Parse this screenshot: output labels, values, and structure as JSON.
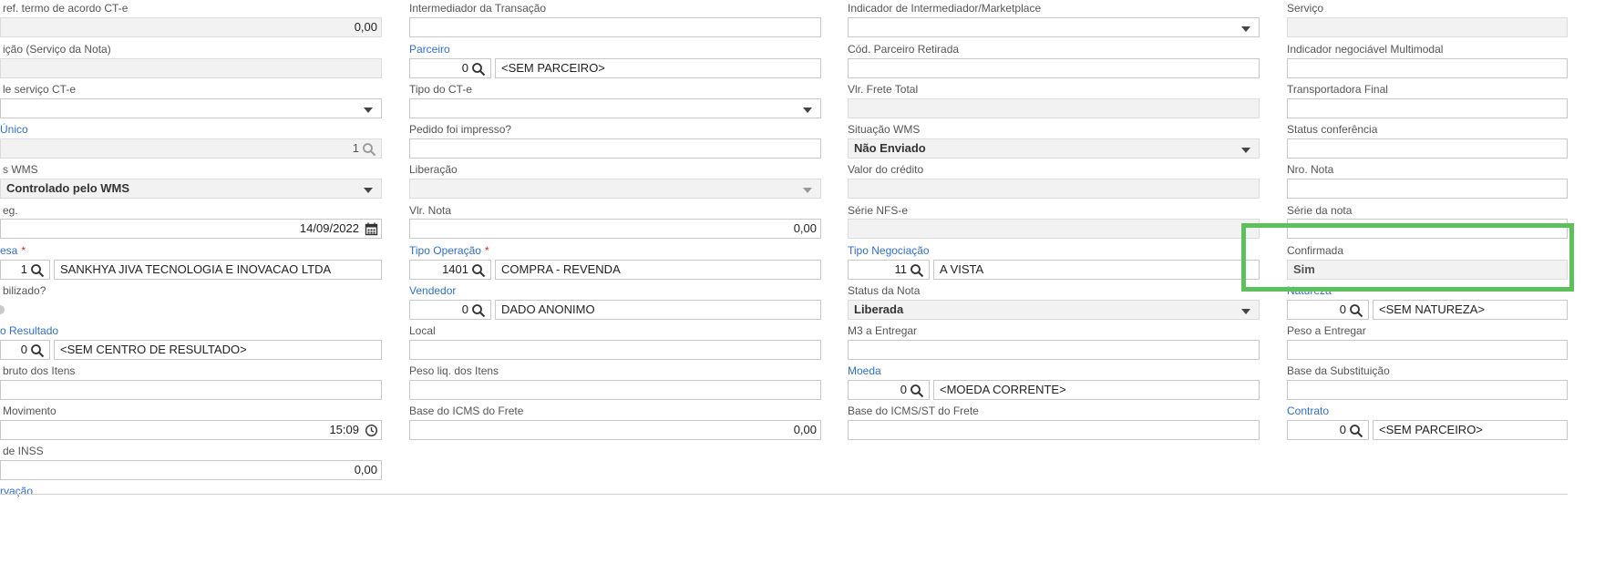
{
  "col1": {
    "ref_termo_label": "ref. termo de acordo CT-e",
    "ref_termo_value": "0,00",
    "servico_nota_label": "ição (Serviço da Nota)",
    "tipo_servico_label": "le serviço CT-e",
    "unico_label": "Único",
    "unico_value": "1",
    "wms_label": "s WMS",
    "wms_value": "Controlado pelo WMS",
    "neg_label": "eg.",
    "neg_value": "14/09/2022",
    "empresa_label": "esa",
    "empresa_code": "1",
    "empresa_name": "SANKHYA JIVA TECNOLOGIA E INOVACAO LTDA",
    "contabilizado_label": "bilizado?",
    "centro_label": "o Resultado",
    "centro_code": "0",
    "centro_name": "<SEM CENTRO DE RESULTADO>",
    "bruto_label": "bruto dos Itens",
    "movimento_label": "Movimento",
    "movimento_value": "15:09",
    "inss_label": "de INSS",
    "inss_value": "0,00",
    "observacao_label": "rvação"
  },
  "col2": {
    "intermediador_label": "Intermediador da Transação",
    "parceiro_label": "Parceiro",
    "parceiro_code": "0",
    "parceiro_name": "<SEM PARCEIRO>",
    "tipo_cte_label": "Tipo do CT-e",
    "pedido_impresso_label": "Pedido foi impresso?",
    "liberacao_label": "Liberação",
    "vlr_nota_label": "Vlr. Nota",
    "vlr_nota_value": "0,00",
    "tipo_operacao_label": "Tipo Operação",
    "tipo_operacao_code": "1401",
    "tipo_operacao_name": "COMPRA - REVENDA",
    "vendedor_label": "Vendedor",
    "vendedor_code": "0",
    "vendedor_name": "DADO ANONIMO",
    "local_label": "Local",
    "peso_liq_label": "Peso liq. dos Itens",
    "base_icms_frete_label": "Base do ICMS do Frete",
    "base_icms_frete_value": "0,00"
  },
  "col3": {
    "indicador_label": "Indicador de Intermediador/Marketplace",
    "cod_parceiro_label": "Cód. Parceiro Retirada",
    "vlr_frete_label": "Vlr. Frete Total",
    "situacao_wms_label": "Situação WMS",
    "situacao_wms_value": "Não Enviado",
    "valor_credito_label": "Valor do crédito",
    "serie_nfse_label": "Série NFS-e",
    "tipo_negociacao_label": "Tipo Negociação",
    "tipo_negociacao_code": "11",
    "tipo_negociacao_name": "A VISTA",
    "status_nota_label": "Status da Nota",
    "status_nota_value": "Liberada",
    "m3_label": "M3 a Entregar",
    "moeda_label": "Moeda",
    "moeda_code": "0",
    "moeda_name": "<MOEDA CORRENTE>",
    "base_icms_st_label": "Base do ICMS/ST do Frete"
  },
  "col4": {
    "servico_label": "Serviço",
    "multimodal_label": "Indicador negociável Multimodal",
    "transportadora_label": "Transportadora Final",
    "status_conferencia_label": "Status conferência",
    "nro_nota_label": "Nro. Nota",
    "serie_nota_label": "Série da nota",
    "confirmada_label": "Confirmada",
    "confirmada_value": "Sim",
    "natureza_label": "Natureza",
    "natureza_code": "0",
    "natureza_name": "<SEM NATUREZA>",
    "peso_entregar_label": "Peso a Entregar",
    "base_substituicao_label": "Base da Substituição",
    "contrato_label": "Contrato",
    "contrato_code": "0",
    "contrato_name": "<SEM PARCEIRO>"
  },
  "colors": {
    "link": "#2f6fd6",
    "highlight": "#5cc15a",
    "required": "#d9262c"
  }
}
